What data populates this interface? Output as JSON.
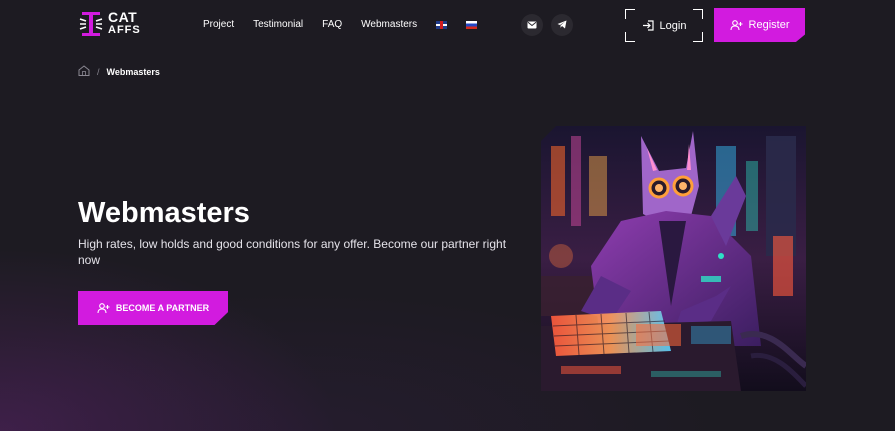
{
  "brand": {
    "line1": "CAT",
    "line2": "AFFS",
    "accent": "#d21bdf"
  },
  "nav": {
    "items": [
      {
        "label": "Project"
      },
      {
        "label": "Testimonial"
      },
      {
        "label": "FAQ"
      },
      {
        "label": "Webmasters"
      }
    ],
    "languages": [
      {
        "icon": "uk-flag-icon"
      },
      {
        "icon": "ru-flag-icon"
      }
    ],
    "social": [
      {
        "icon": "mail-icon"
      },
      {
        "icon": "telegram-icon"
      }
    ]
  },
  "header": {
    "login_label": "Login",
    "register_label": "Register"
  },
  "breadcrumb": {
    "home_icon": "home-icon",
    "separator": "/",
    "current": "Webmasters"
  },
  "hero": {
    "title": "Webmasters",
    "subtitle": "High rates, low holds and good conditions for any offer. Become our partner right now",
    "cta_label": "BECOME A PARTNER",
    "image_icon": "cyber-cat-illustration"
  },
  "colors": {
    "background": "#1d1b22",
    "accent": "#d21bdf"
  }
}
